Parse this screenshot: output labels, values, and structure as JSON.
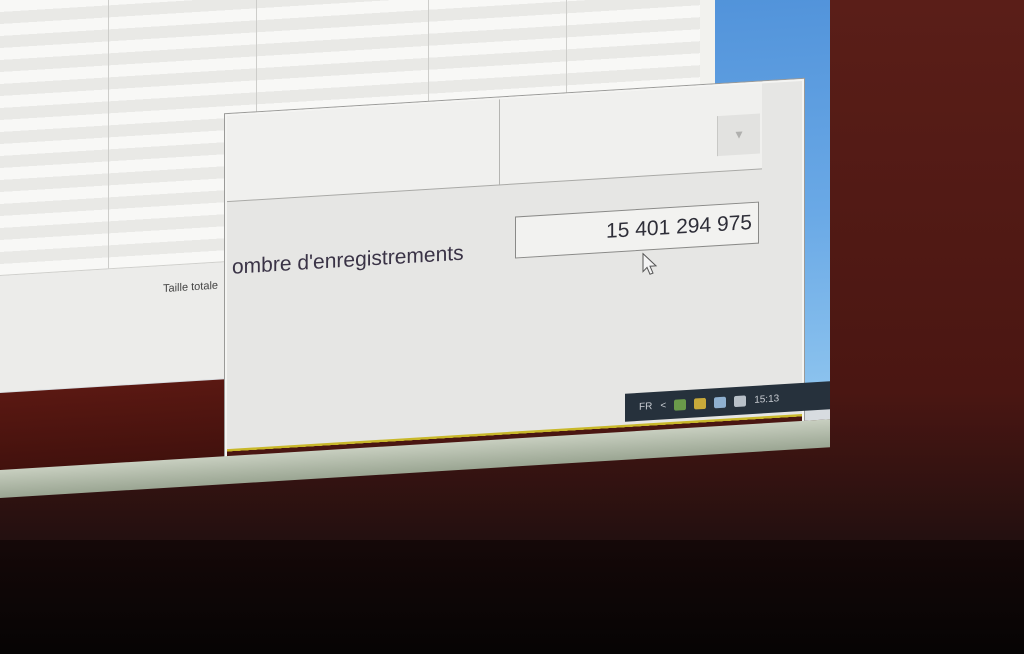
{
  "background_window": {
    "total_size_label": "Taille totale"
  },
  "dialog": {
    "record_count_label": "ombre d'enregistrements",
    "record_count_value": "15 401 294 975"
  },
  "tray": {
    "language": "FR",
    "show_hidden_glyph": "<",
    "clock": "15:13"
  },
  "icons": [
    "chevron-down-icon",
    "mouse-cursor-icon",
    "network-icon",
    "volume-icon"
  ],
  "colors": {
    "desktop_blue": "#4d8fd8",
    "bezel": "#4a1612",
    "taskbar_accent": "#c9b82a"
  }
}
